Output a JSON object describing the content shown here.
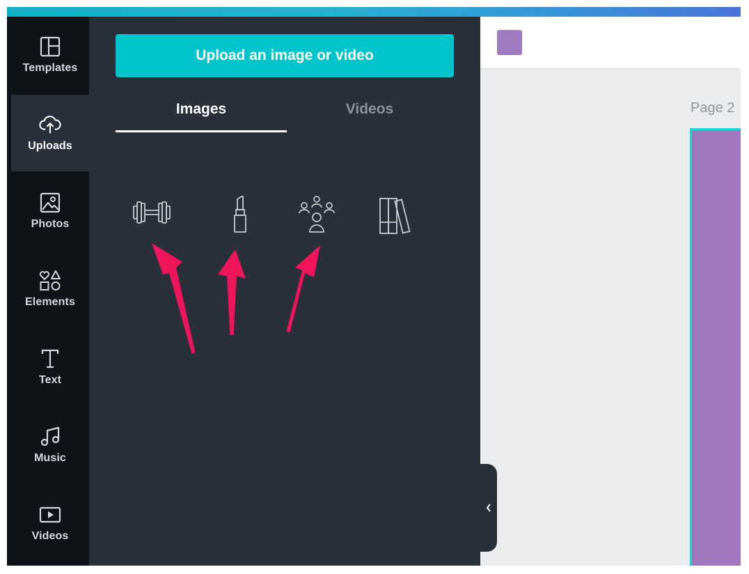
{
  "colors": {
    "accent": "#00c4cc",
    "rail_bg": "#0e1318",
    "panel_bg": "#293039",
    "canvas_bg": "#ebecee",
    "page_fill": "#a077bc",
    "page_border": "#1fd1d6",
    "annotation_arrow": "#f0145a"
  },
  "sidebar": {
    "items": [
      {
        "label": "Templates",
        "icon": "templates-icon"
      },
      {
        "label": "Uploads",
        "icon": "cloud-upload-icon",
        "active": true
      },
      {
        "label": "Photos",
        "icon": "image-icon"
      },
      {
        "label": "Elements",
        "icon": "shapes-icon"
      },
      {
        "label": "Text",
        "icon": "text-icon"
      },
      {
        "label": "Music",
        "icon": "music-note-icon"
      },
      {
        "label": "Videos",
        "icon": "video-play-icon"
      }
    ]
  },
  "panel": {
    "upload_label": "Upload an image or video",
    "tabs": [
      {
        "label": "Images",
        "active": true
      },
      {
        "label": "Videos",
        "active": false
      }
    ],
    "illustrations": [
      "dumbbell-icon",
      "lipstick-icon",
      "audience-icon",
      "books-icon"
    ],
    "collapse_icon": "chevron-left-icon"
  },
  "canvas": {
    "page_label": "Page 2",
    "swatch_color": "#a07bbf"
  }
}
